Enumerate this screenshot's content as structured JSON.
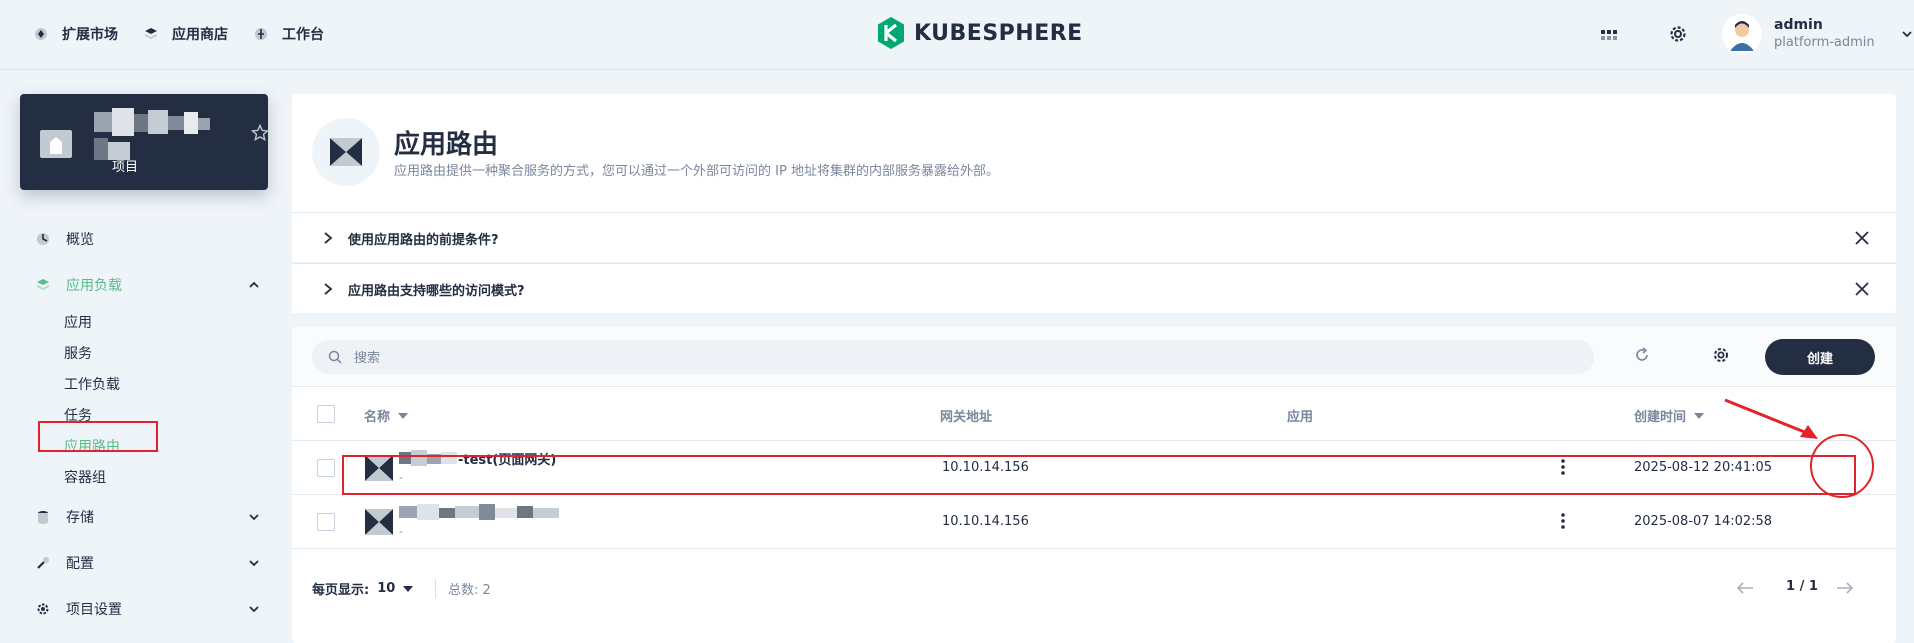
{
  "topbar": {
    "nav": [
      {
        "label": "扩展市场",
        "icon": "extension-icon"
      },
      {
        "label": "应用商店",
        "icon": "app-store-icon"
      },
      {
        "label": "工作台",
        "icon": "workbench-icon"
      }
    ],
    "logo_text": "KUBESPHERE",
    "user": {
      "name": "admin",
      "role": "platform-admin"
    }
  },
  "project": {
    "type_label": "项目"
  },
  "sidebar": {
    "overview": "概览",
    "workloads": {
      "label": "应用负载",
      "expanded": true
    },
    "workload_items": [
      "应用",
      "服务",
      "工作负载",
      "任务",
      "应用路由",
      "容器组"
    ],
    "active_item": "应用路由",
    "storage": "存储",
    "config": "配置",
    "project_settings": "项目设置"
  },
  "header": {
    "title": "应用路由",
    "description": "应用路由提供一种聚合服务的方式，您可以通过一个外部可访问的 IP 地址将集群的内部服务暴露给外部。"
  },
  "faqs": [
    {
      "question": "使用应用路由的前提条件?"
    },
    {
      "question": "应用路由支持哪些的访问模式?"
    }
  ],
  "toolbar": {
    "search_placeholder": "搜索",
    "create_label": "创建"
  },
  "table": {
    "columns": {
      "name": "名称",
      "gateway": "网关地址",
      "app": "应用",
      "created": "创建时间"
    },
    "rows": [
      {
        "name_suffix": "-test(页面网关)",
        "sub": "-",
        "gateway": "10.10.14.156",
        "app": "",
        "created": "2025-08-12 20:41:05"
      },
      {
        "name_suffix": "",
        "sub": "-",
        "gateway": "10.10.14.156",
        "app": "",
        "created": "2025-08-07 14:02:58"
      }
    ]
  },
  "footer": {
    "pagesize_label": "每页显示:",
    "pagesize_value": "10",
    "total_label": "总数:",
    "total_value": "2",
    "page_indicator": "1 / 1"
  },
  "colors": {
    "accent": "#55bc8a",
    "dark": "#242e42",
    "annotation": "#e0232c"
  }
}
